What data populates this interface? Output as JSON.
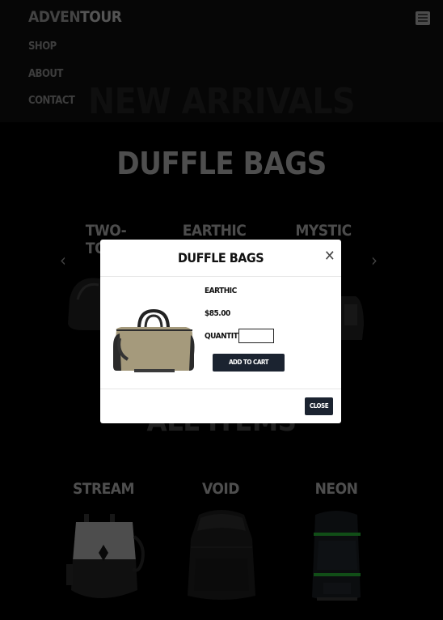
{
  "header": {
    "logo_part1": "ADVEN",
    "logo_part2": "TOUR",
    "nav": [
      "SHOP",
      "ABOUT",
      "CONTACT"
    ],
    "hero_title": "NEW ARRIVALS",
    "menu_icon": "hamburger-icon"
  },
  "duffle": {
    "title": "DUFFLE BAGS",
    "categories": [
      "TWO-TONE",
      "EARTHIC",
      "MYSTIC"
    ],
    "prev_icon": "chevron-left-icon",
    "next_icon": "chevron-right-icon"
  },
  "modal": {
    "title": "DUFFLE BAGS",
    "close_icon": "close-icon",
    "product_name": "EARTHIC",
    "price": "$85.00",
    "quantity_label": "QUANTITY:",
    "quantity_value": "",
    "add_button": "ADD TO CART",
    "close_button": "CLOSE"
  },
  "all_items": {
    "title": "ALL ITEMS",
    "items": [
      "STREAM",
      "VOID",
      "NEON"
    ]
  }
}
